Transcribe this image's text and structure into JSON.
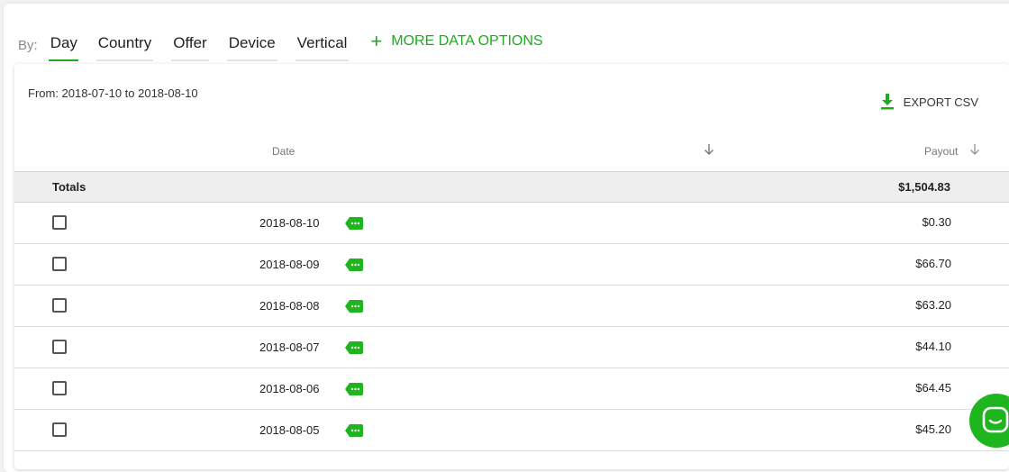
{
  "tabs": {
    "by_label": "By:",
    "items": [
      {
        "label": "Day",
        "active": true
      },
      {
        "label": "Country",
        "active": false
      },
      {
        "label": "Offer",
        "active": false
      },
      {
        "label": "Device",
        "active": false
      },
      {
        "label": "Vertical",
        "active": false
      }
    ],
    "more_options": "MORE DATA OPTIONS"
  },
  "report": {
    "range": "From: 2018-07-10 to 2018-08-10",
    "export_label": "EXPORT CSV",
    "columns": {
      "date": "Date",
      "payout": "Payout"
    },
    "totals": {
      "label": "Totals",
      "payout": "$1,504.83"
    },
    "rows": [
      {
        "date": "2018-08-10",
        "payout": "$0.30"
      },
      {
        "date": "2018-08-09",
        "payout": "$66.70"
      },
      {
        "date": "2018-08-08",
        "payout": "$63.20"
      },
      {
        "date": "2018-08-07",
        "payout": "$44.10"
      },
      {
        "date": "2018-08-06",
        "payout": "$64.45"
      },
      {
        "date": "2018-08-05",
        "payout": "$45.20"
      }
    ]
  },
  "icons": {
    "add": "plus-icon",
    "export": "download-icon",
    "sort": "arrow-down-icon",
    "tag": "tag-icon",
    "chat": "chat-icon"
  },
  "colors": {
    "accent": "#1faa1f",
    "totals_bg": "#eeeeee"
  }
}
